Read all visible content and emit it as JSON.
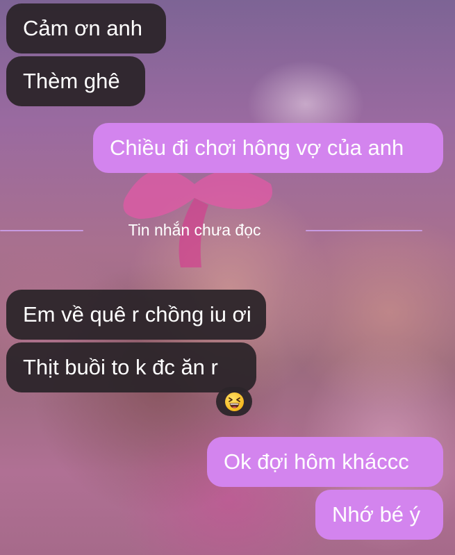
{
  "chat": {
    "messages_before": [
      {
        "text": "Cảm ơn anh",
        "direction": "incoming"
      },
      {
        "text": "Thèm ghê",
        "direction": "incoming"
      },
      {
        "text": "Chiều đi chơi hông vợ của anh",
        "direction": "outgoing"
      }
    ],
    "unread_divider": "Tin nhắn chưa đọc",
    "messages_after": [
      {
        "text": "Em về quê r chồng iu ơi",
        "direction": "incoming"
      },
      {
        "text": "Thịt buồi to k đc ăn r",
        "direction": "incoming",
        "reaction": "😆"
      },
      {
        "text": "Ok đợi hôm kháccc",
        "direction": "outgoing"
      },
      {
        "text": "Nhớ bé ý",
        "direction": "outgoing"
      }
    ]
  },
  "colors": {
    "incoming_bubble": "#2c252a",
    "outgoing_bubble": "#d384ee",
    "divider_line": "#c79ae0",
    "text": "#ffffff"
  },
  "icons": {
    "reaction": "grinning-squinting-face-icon"
  }
}
